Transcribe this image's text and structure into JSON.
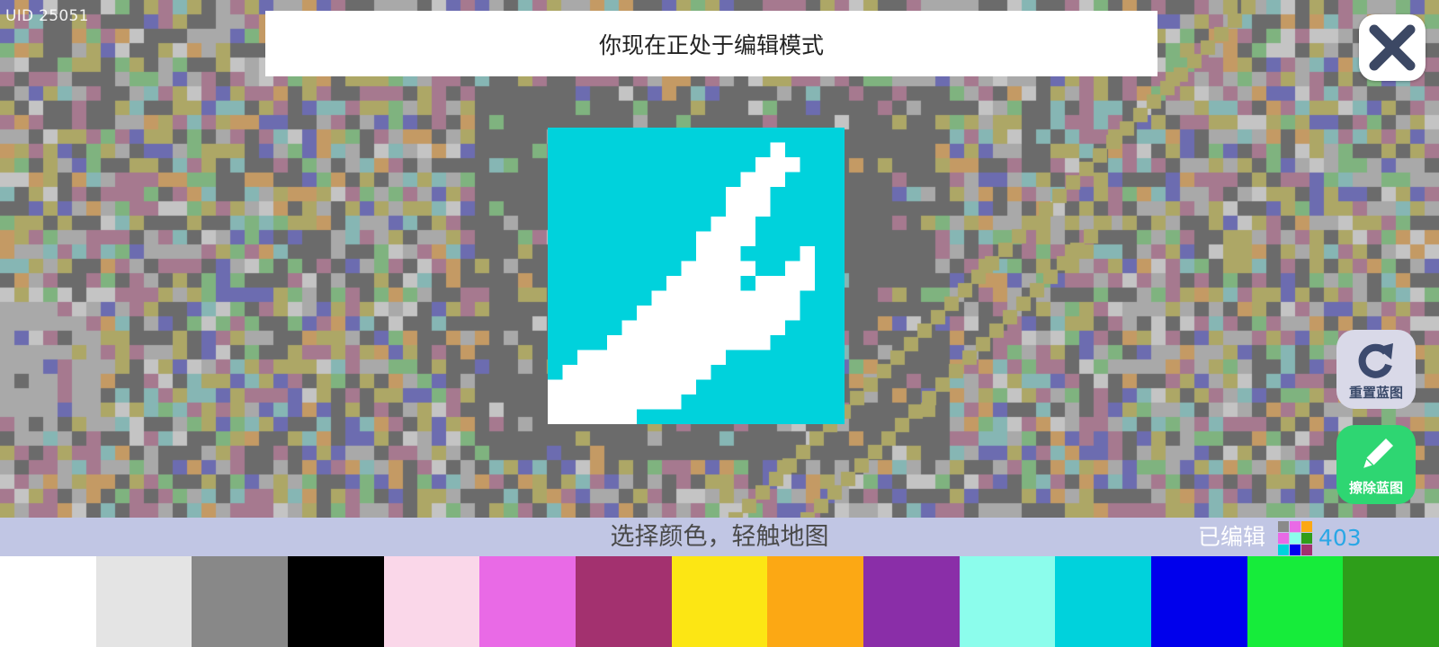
{
  "uid_label": "UID 25051",
  "banner_text": "你现在正处于编辑模式",
  "buttons": {
    "reset_label": "重置蓝图",
    "erase_label": "擦除蓝图"
  },
  "status": {
    "hint": "选择颜色，轻触地图",
    "edited_label": "已编辑",
    "edited_count": "403"
  },
  "icons": {
    "close": "close-icon",
    "reset": "rotate-icon",
    "erase": "pencil-icon",
    "edited": "pixel-grid-icon"
  },
  "palette": [
    {
      "name": "white",
      "color": "#ffffff"
    },
    {
      "name": "light-gray",
      "color": "#e4e4e4"
    },
    {
      "name": "gray",
      "color": "#888888"
    },
    {
      "name": "black",
      "color": "#000000"
    },
    {
      "name": "light-pink",
      "color": "#fad7e9"
    },
    {
      "name": "pink",
      "color": "#e96ae6"
    },
    {
      "name": "maroon",
      "color": "#a3316f"
    },
    {
      "name": "yellow",
      "color": "#fce614"
    },
    {
      "name": "orange",
      "color": "#fca814"
    },
    {
      "name": "purple",
      "color": "#8a2ea8"
    },
    {
      "name": "aqua",
      "color": "#8cfdec"
    },
    {
      "name": "cyan",
      "color": "#00d2dc"
    },
    {
      "name": "blue",
      "color": "#0000ec"
    },
    {
      "name": "green",
      "color": "#16ec3a"
    },
    {
      "name": "dark-green",
      "color": "#2e9e1a"
    }
  ],
  "preview": {
    "background": "#00d2dc",
    "foreground": "#ffffff"
  }
}
